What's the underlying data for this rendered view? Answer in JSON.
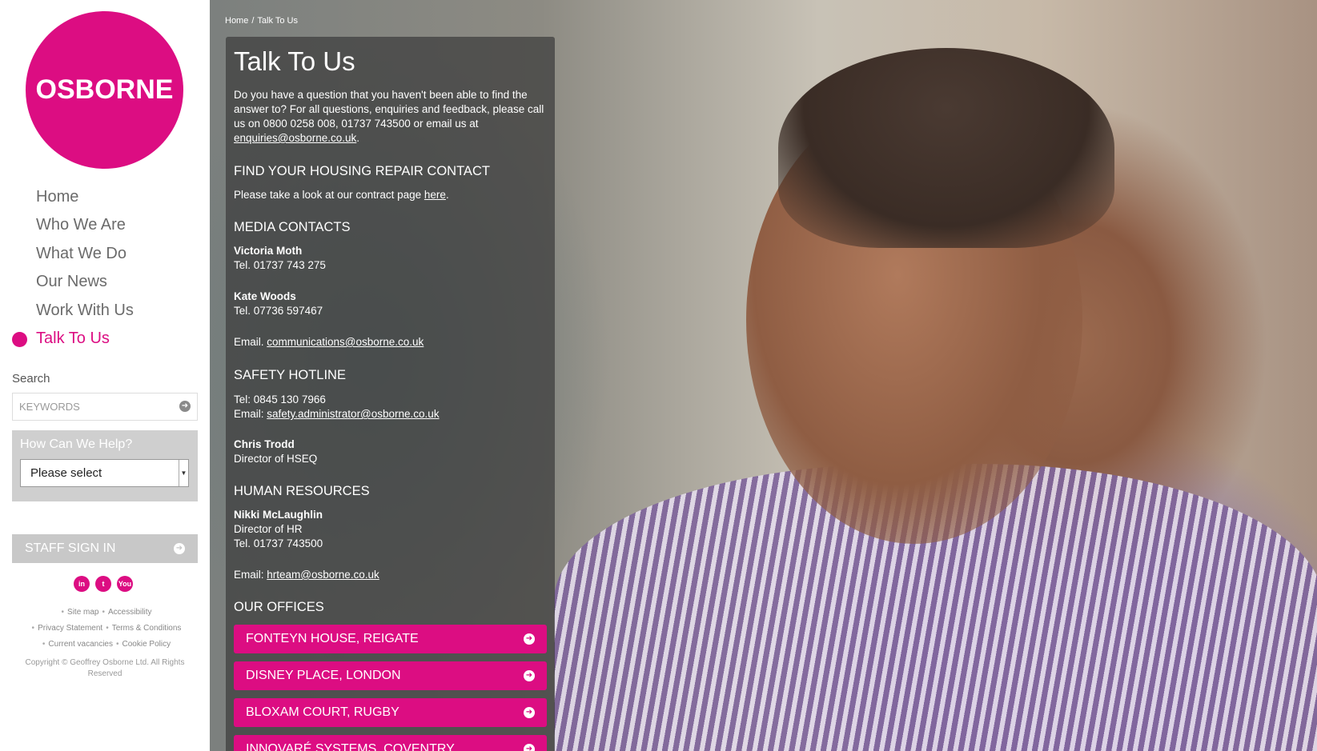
{
  "brand": {
    "logo_text": "OSBORNE",
    "accent": "#dc0d82"
  },
  "nav": {
    "items": [
      {
        "label": "Home"
      },
      {
        "label": "Who We Are"
      },
      {
        "label": "What We Do"
      },
      {
        "label": "Our News"
      },
      {
        "label": "Work With Us"
      },
      {
        "label": "Talk To Us",
        "active": true
      }
    ]
  },
  "search": {
    "label": "Search",
    "placeholder": "KEYWORDS"
  },
  "help": {
    "title": "How Can We Help?",
    "selected": "Please select"
  },
  "staff": {
    "label": "STAFF SIGN IN"
  },
  "social": {
    "icons": [
      "linkedin-icon",
      "twitter-icon",
      "youtube-icon"
    ],
    "linkedin": "in",
    "twitter": "t",
    "youtube": "You"
  },
  "footer": {
    "links_row1": [
      "Site map",
      "Accessibility"
    ],
    "links_row2": [
      "Privacy Statement",
      "Terms & Conditions"
    ],
    "links_row3": [
      "Current vacancies",
      "Cookie Policy"
    ],
    "copyright": "Copyright © Geoffrey Osborne Ltd. All Rights Reserved"
  },
  "breadcrumb": {
    "home": "Home",
    "separator": "/",
    "current": "Talk To Us"
  },
  "content": {
    "title": "Talk To Us",
    "intro_text": "Do you have a question that you haven't been able to find the answer to? For all questions, enquiries and feedback, please call us on 0800 0258 008, 01737 743500 or email us at ",
    "intro_email": "enquiries@osborne.co.uk",
    "intro_end": ".",
    "housing": {
      "heading": "FIND YOUR HOUSING REPAIR CONTACT",
      "text": "Please take a look at our contract page ",
      "link": "here",
      "end": "."
    },
    "media": {
      "heading": "MEDIA CONTACTS",
      "contact1_name": "Victoria Moth",
      "contact1_tel": "Tel. 01737 743 275",
      "contact2_name": "Kate Woods",
      "contact2_tel": "Tel. 07736 597467",
      "email_label": "Email. ",
      "email": "communications@osborne.co.uk"
    },
    "safety": {
      "heading": "SAFETY HOTLINE",
      "tel": "Tel: 0845 130 7966",
      "email_label": "Email:  ",
      "email": "safety.administrator@osborne.co.uk",
      "contact_name": "Chris Trodd",
      "contact_role": "Director of HSEQ"
    },
    "hr": {
      "heading": "HUMAN RESOURCES",
      "contact_name": "Nikki McLaughlin",
      "contact_role": "Director of HR",
      "tel": "Tel. 01737 743500",
      "email_label": "Email: ",
      "email": "hrteam@osborne.co.uk"
    },
    "offices": {
      "heading": "OUR OFFICES",
      "items": [
        {
          "label": "FONTEYN HOUSE, REIGATE"
        },
        {
          "label": "DISNEY PLACE, LONDON"
        },
        {
          "label": "BLOXAM COURT, RUGBY"
        },
        {
          "label": "INNOVARÉ SYSTEMS, COVENTRY"
        }
      ]
    }
  }
}
